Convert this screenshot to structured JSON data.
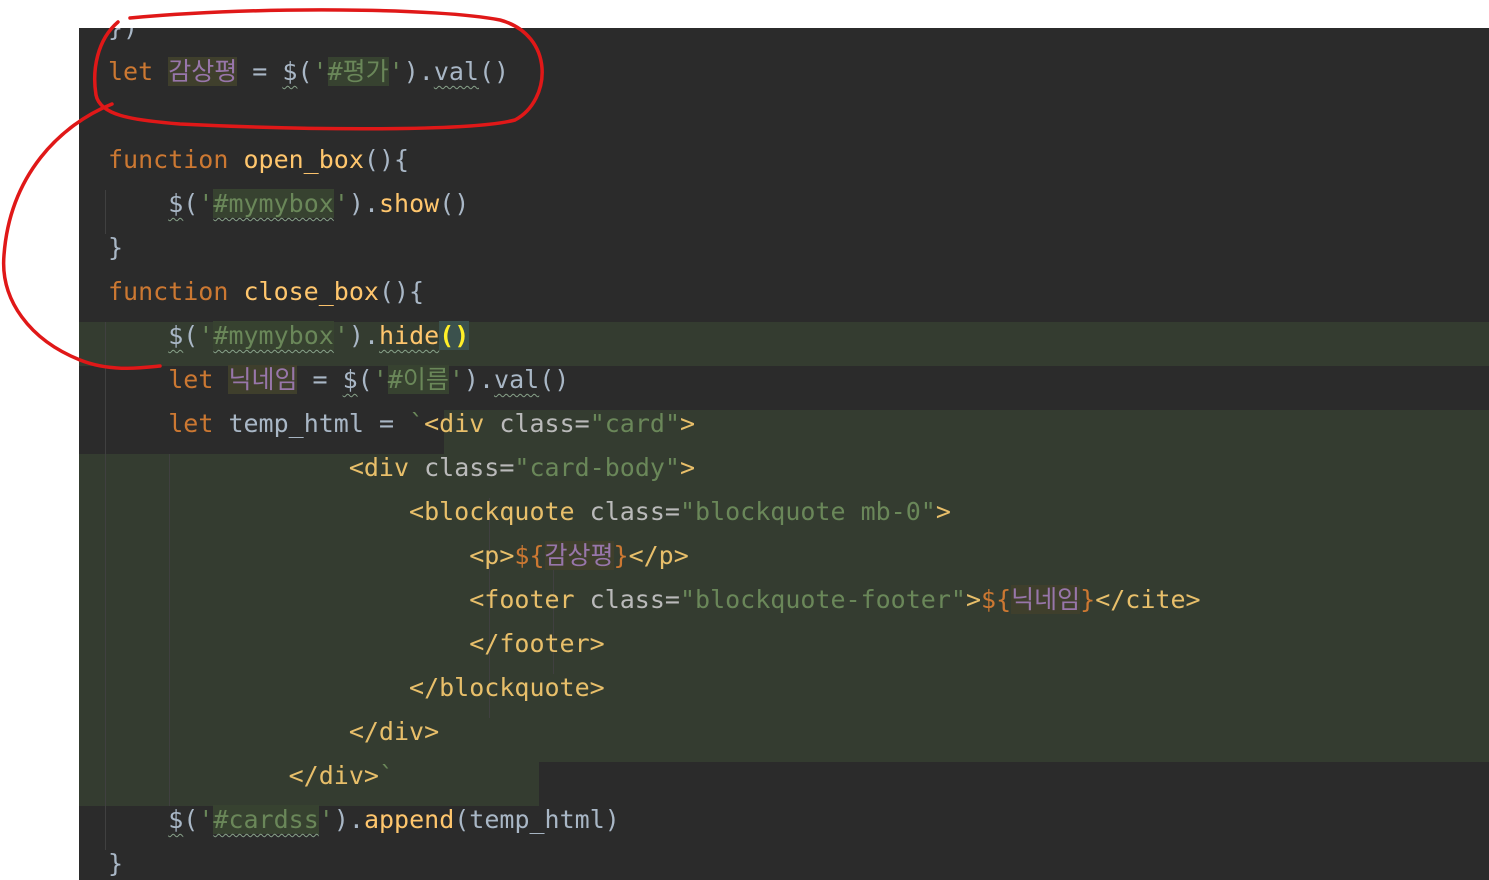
{
  "editor": {
    "lines": [
      {
        "name": "code-line-1",
        "tokens": [
          {
            "c": "pun",
            "t": "})"
          }
        ]
      },
      {
        "name": "code-line-2",
        "tokens": [
          {
            "c": "kw",
            "t": "let "
          },
          {
            "c": "var hl",
            "t": "감상평"
          },
          {
            "c": "pun",
            "t": " = "
          },
          {
            "c": "pun squig",
            "t": "$"
          },
          {
            "c": "pun",
            "t": "("
          },
          {
            "c": "str",
            "t": "'"
          },
          {
            "c": "str strbg",
            "t": "#평가"
          },
          {
            "c": "str",
            "t": "'"
          },
          {
            "c": "pun",
            "t": ")."
          },
          {
            "c": "pun squig",
            "t": "val"
          },
          {
            "c": "pun",
            "t": "()"
          }
        ]
      },
      {
        "name": "code-line-3",
        "tokens": []
      },
      {
        "name": "code-line-4",
        "tokens": [
          {
            "c": "kw",
            "t": "function "
          },
          {
            "c": "fn",
            "t": "open_box"
          },
          {
            "c": "pun",
            "t": "(){"
          }
        ]
      },
      {
        "name": "code-line-5",
        "tokens": [
          {
            "c": "pun",
            "t": "    "
          },
          {
            "c": "pun squig",
            "t": "$"
          },
          {
            "c": "pun",
            "t": "("
          },
          {
            "c": "str",
            "t": "'"
          },
          {
            "c": "str strbg squig",
            "t": "#mymybox"
          },
          {
            "c": "str",
            "t": "'"
          },
          {
            "c": "pun",
            "t": ")."
          },
          {
            "c": "fn",
            "t": "show"
          },
          {
            "c": "pun",
            "t": "()"
          }
        ]
      },
      {
        "name": "code-line-6",
        "tokens": [
          {
            "c": "pun",
            "t": "}"
          }
        ]
      },
      {
        "name": "code-line-7",
        "tokens": [
          {
            "c": "kw",
            "t": "function "
          },
          {
            "c": "fn",
            "t": "close_box"
          },
          {
            "c": "pun",
            "t": "(){"
          }
        ]
      },
      {
        "name": "code-line-8",
        "tokens": [
          {
            "c": "pun",
            "t": "    "
          },
          {
            "c": "pun squig",
            "t": "$"
          },
          {
            "c": "pun",
            "t": "("
          },
          {
            "c": "str",
            "t": "'"
          },
          {
            "c": "str strbg squig",
            "t": "#mymybox"
          },
          {
            "c": "str",
            "t": "'"
          },
          {
            "c": "pun",
            "t": ")."
          },
          {
            "c": "fn squig",
            "t": "hide"
          },
          {
            "c": "brace-match",
            "t": "()"
          }
        ]
      },
      {
        "name": "code-line-9",
        "tokens": [
          {
            "c": "pun",
            "t": "    "
          },
          {
            "c": "kw",
            "t": "let "
          },
          {
            "c": "var hl",
            "t": "닉네임"
          },
          {
            "c": "pun",
            "t": " = "
          },
          {
            "c": "pun squig",
            "t": "$"
          },
          {
            "c": "pun",
            "t": "("
          },
          {
            "c": "str",
            "t": "'"
          },
          {
            "c": "str strbg",
            "t": "#이름"
          },
          {
            "c": "str",
            "t": "'"
          },
          {
            "c": "pun",
            "t": ")."
          },
          {
            "c": "pun squig",
            "t": "val"
          },
          {
            "c": "pun",
            "t": "()"
          }
        ]
      },
      {
        "name": "code-line-10",
        "tokens": [
          {
            "c": "pun",
            "t": "    "
          },
          {
            "c": "kw",
            "t": "let "
          },
          {
            "c": "pun",
            "t": "temp_html = "
          },
          {
            "c": "str",
            "t": "`"
          },
          {
            "c": "tag",
            "t": "<div "
          },
          {
            "c": "attr",
            "t": "class="
          },
          {
            "c": "str",
            "t": "\"card\""
          },
          {
            "c": "tag",
            "t": ">"
          }
        ]
      },
      {
        "name": "code-line-11",
        "tokens": [
          {
            "c": "pun",
            "t": "                "
          },
          {
            "c": "tag",
            "t": "<div "
          },
          {
            "c": "attr",
            "t": "class="
          },
          {
            "c": "str",
            "t": "\"card-body\""
          },
          {
            "c": "tag",
            "t": ">"
          }
        ]
      },
      {
        "name": "code-line-12",
        "tokens": [
          {
            "c": "pun",
            "t": "                    "
          },
          {
            "c": "tag",
            "t": "<blockquote "
          },
          {
            "c": "attr",
            "t": "class="
          },
          {
            "c": "str",
            "t": "\"blockquote mb-0\""
          },
          {
            "c": "tag",
            "t": ">"
          }
        ]
      },
      {
        "name": "code-line-13",
        "tokens": [
          {
            "c": "pun",
            "t": "                        "
          },
          {
            "c": "tag",
            "t": "<p>"
          },
          {
            "c": "kw",
            "t": "${"
          },
          {
            "c": "var hl",
            "t": "감상평"
          },
          {
            "c": "kw",
            "t": "}"
          },
          {
            "c": "tag",
            "t": "</p>"
          }
        ]
      },
      {
        "name": "code-line-14",
        "tokens": [
          {
            "c": "pun",
            "t": "                        "
          },
          {
            "c": "tag",
            "t": "<footer "
          },
          {
            "c": "attr",
            "t": "class="
          },
          {
            "c": "str",
            "t": "\"blockquote-footer\""
          },
          {
            "c": "tag",
            "t": ">"
          },
          {
            "c": "kw",
            "t": "${"
          },
          {
            "c": "var hl",
            "t": "닉네임"
          },
          {
            "c": "kw",
            "t": "}"
          },
          {
            "c": "tag",
            "t": "</cite>"
          }
        ]
      },
      {
        "name": "code-line-15",
        "tokens": [
          {
            "c": "pun",
            "t": "                        "
          },
          {
            "c": "tag",
            "t": "</footer>"
          }
        ]
      },
      {
        "name": "code-line-16",
        "tokens": [
          {
            "c": "pun",
            "t": "                    "
          },
          {
            "c": "tag",
            "t": "</blockquote>"
          }
        ]
      },
      {
        "name": "code-line-17",
        "tokens": [
          {
            "c": "pun",
            "t": "                "
          },
          {
            "c": "tag",
            "t": "</div>"
          }
        ]
      },
      {
        "name": "code-line-18",
        "tokens": [
          {
            "c": "pun",
            "t": "            "
          },
          {
            "c": "tag",
            "t": "</div>"
          },
          {
            "c": "str",
            "t": "`"
          }
        ]
      },
      {
        "name": "code-line-19",
        "tokens": [
          {
            "c": "pun",
            "t": "    "
          },
          {
            "c": "pun squig",
            "t": "$"
          },
          {
            "c": "pun",
            "t": "("
          },
          {
            "c": "str",
            "t": "'"
          },
          {
            "c": "str strbg squig",
            "t": "#cardss"
          },
          {
            "c": "str",
            "t": "'"
          },
          {
            "c": "pun",
            "t": ")."
          },
          {
            "c": "fn",
            "t": "append"
          },
          {
            "c": "pun",
            "t": "(temp_html)"
          }
        ]
      },
      {
        "name": "code-line-20",
        "tokens": [
          {
            "c": "pun",
            "t": "}"
          }
        ]
      }
    ]
  },
  "colors": {
    "background": "#2b2b2b",
    "keyword": "#cc7832",
    "function": "#ffc66d",
    "string": "#6a8759",
    "variable": "#9876aa",
    "tag": "#e8bf6a",
    "annotation": "#e01818"
  }
}
